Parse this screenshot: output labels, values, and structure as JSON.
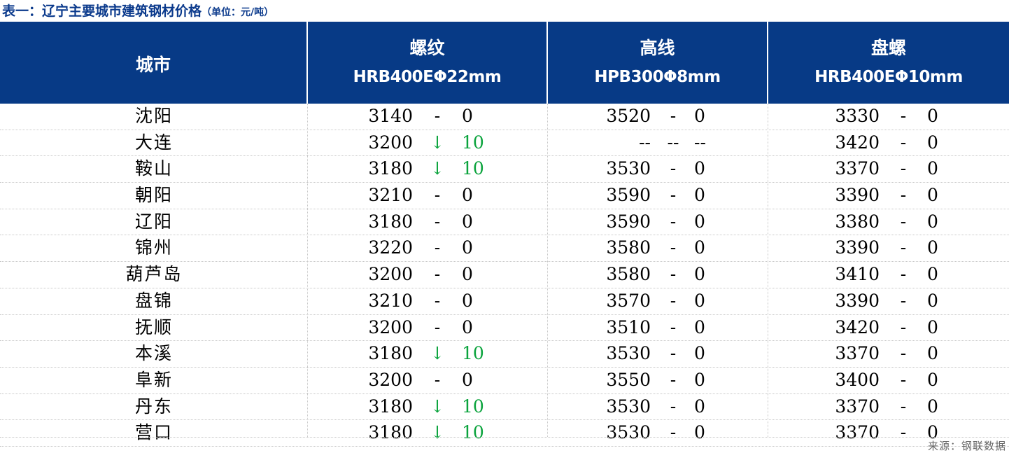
{
  "title": {
    "main": "表一：辽宁主要城市建筑钢材价格",
    "unit": "（单位：元/吨）"
  },
  "header": {
    "city": "城市",
    "columns": [
      {
        "name": "螺纹",
        "spec": "HRB400EΦ22mm"
      },
      {
        "name": "高线",
        "spec": "HPB300Φ8mm"
      },
      {
        "name": "盘螺",
        "spec": "HRB400EΦ10mm"
      }
    ]
  },
  "rows": [
    {
      "city": "沈阳",
      "p1": "3140",
      "m1": "-",
      "c1": "0",
      "p2": "3520",
      "m2": "-",
      "c2": "0",
      "p3": "3330",
      "m3": "-",
      "c3": "0"
    },
    {
      "city": "大连",
      "p1": "3200",
      "m1": "↓",
      "c1": "10",
      "p2": "--",
      "m2": "--",
      "c2": "--",
      "p3": "3420",
      "m3": "-",
      "c3": "0"
    },
    {
      "city": "鞍山",
      "p1": "3180",
      "m1": "↓",
      "c1": "10",
      "p2": "3530",
      "m2": "-",
      "c2": "0",
      "p3": "3370",
      "m3": "-",
      "c3": "0"
    },
    {
      "city": "朝阳",
      "p1": "3210",
      "m1": "-",
      "c1": "0",
      "p2": "3590",
      "m2": "-",
      "c2": "0",
      "p3": "3390",
      "m3": "-",
      "c3": "0"
    },
    {
      "city": "辽阳",
      "p1": "3180",
      "m1": "-",
      "c1": "0",
      "p2": "3590",
      "m2": "-",
      "c2": "0",
      "p3": "3380",
      "m3": "-",
      "c3": "0"
    },
    {
      "city": "锦州",
      "p1": "3220",
      "m1": "-",
      "c1": "0",
      "p2": "3580",
      "m2": "-",
      "c2": "0",
      "p3": "3390",
      "m3": "-",
      "c3": "0"
    },
    {
      "city": "葫芦岛",
      "p1": "3200",
      "m1": "-",
      "c1": "0",
      "p2": "3580",
      "m2": "-",
      "c2": "0",
      "p3": "3410",
      "m3": "-",
      "c3": "0"
    },
    {
      "city": "盘锦",
      "p1": "3210",
      "m1": "-",
      "c1": "0",
      "p2": "3570",
      "m2": "-",
      "c2": "0",
      "p3": "3390",
      "m3": "-",
      "c3": "0"
    },
    {
      "city": "抚顺",
      "p1": "3200",
      "m1": "-",
      "c1": "0",
      "p2": "3510",
      "m2": "-",
      "c2": "0",
      "p3": "3420",
      "m3": "-",
      "c3": "0"
    },
    {
      "city": "本溪",
      "p1": "3180",
      "m1": "↓",
      "c1": "10",
      "p2": "3530",
      "m2": "-",
      "c2": "0",
      "p3": "3370",
      "m3": "-",
      "c3": "0"
    },
    {
      "city": "阜新",
      "p1": "3200",
      "m1": "-",
      "c1": "0",
      "p2": "3550",
      "m2": "-",
      "c2": "0",
      "p3": "3400",
      "m3": "-",
      "c3": "0"
    },
    {
      "city": "丹东",
      "p1": "3180",
      "m1": "↓",
      "c1": "10",
      "p2": "3530",
      "m2": "-",
      "c2": "0",
      "p3": "3370",
      "m3": "-",
      "c3": "0"
    },
    {
      "city": "营口",
      "p1": "3180",
      "m1": "↓",
      "c1": "10",
      "p2": "3530",
      "m2": "-",
      "c2": "0",
      "p3": "3370",
      "m3": "-",
      "c3": "0"
    }
  ],
  "colors": {
    "header_bg": "#073a86",
    "title": "#0b3a8c",
    "decrease": "#0aa33c"
  },
  "source": "来源：钢联数据"
}
